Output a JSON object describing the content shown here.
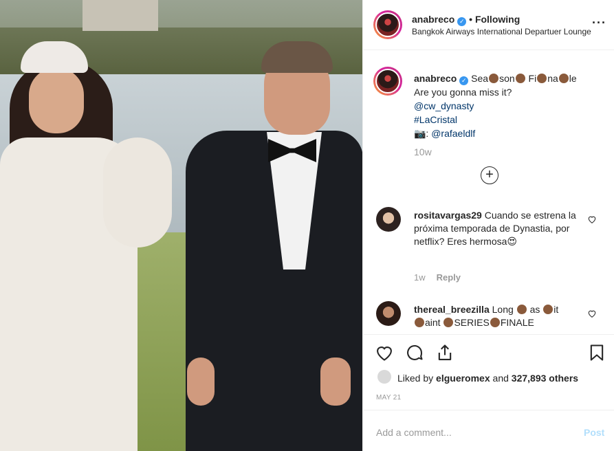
{
  "header": {
    "username": "anabreco",
    "follow_status": "Following",
    "location": "Bangkok Airways International Departuer Lounge"
  },
  "caption": {
    "username": "anabreco",
    "line1_parts": [
      "Sea",
      "son",
      "Fi",
      "na",
      "le"
    ],
    "line2": "Are you gonna miss it?",
    "mention": "@cw_dynasty",
    "hashtag": "#LaCristal",
    "photo_credit_prefix": "📷: ",
    "photo_credit": "@rafaeldlf",
    "time": "10w"
  },
  "comments": [
    {
      "username": "rositavargas29",
      "text": "Cuando se estrena la próxima temporada de Dynastia, por netflix? Eres hermosa",
      "time": "1w",
      "reply_label": "Reply"
    },
    {
      "username": "thereal_breezilla",
      "text_parts": [
        "Long",
        "as",
        "it",
        "aint",
        "SERIES",
        "FINALE"
      ]
    }
  ],
  "likes": {
    "prefix": "Liked by ",
    "user": "elgueromex",
    "middle": " and ",
    "count": "327,893 others"
  },
  "date": "MAY 21",
  "add_comment": {
    "placeholder": "Add a comment...",
    "post_label": "Post"
  },
  "icons": {
    "more": "more-options-icon",
    "like": "heart-icon",
    "comment": "comment-icon",
    "share": "share-icon",
    "save": "bookmark-icon",
    "load_more": "plus-circle-icon"
  },
  "colors": {
    "verified": "#3897f0",
    "link": "#003569",
    "muted": "#999999",
    "post_disabled": "#b2dffc"
  }
}
